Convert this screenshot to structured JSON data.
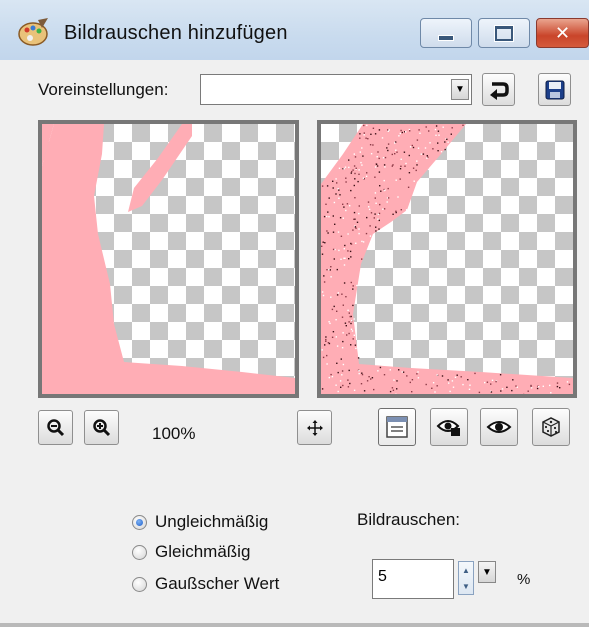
{
  "window": {
    "title": "Bildrauschen hinzufügen",
    "icon": "paint-palette-icon"
  },
  "presets": {
    "label": "Voreinstellungen:",
    "value": ""
  },
  "preview": {
    "zoom_label": "100%"
  },
  "options": {
    "radios": [
      {
        "label": "Ungleichmäßig",
        "checked": true
      },
      {
        "label": "Gleichmäßig",
        "checked": false
      },
      {
        "label": "Gaußscher Wert",
        "checked": false
      }
    ],
    "noise_label": "Bildrauschen:",
    "noise_value": "5",
    "unit": "%"
  },
  "colors": {
    "shape_fill": "#ffadb5",
    "titlebar": "#c9dbee",
    "close_button": "#c9452a"
  }
}
